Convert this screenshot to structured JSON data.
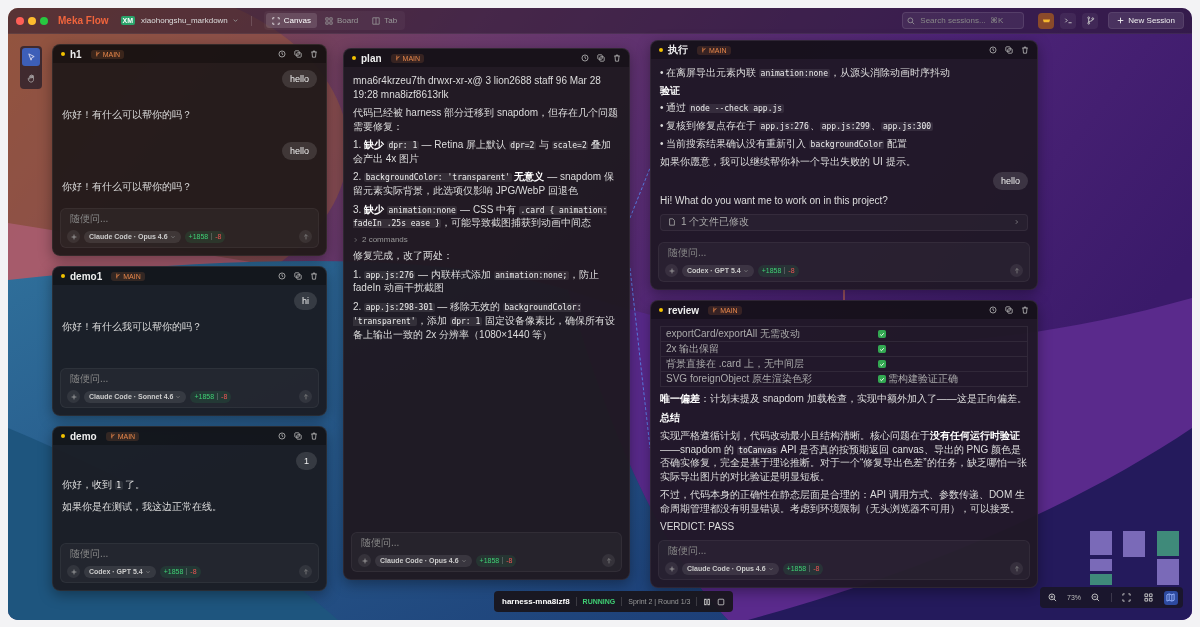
{
  "window": {
    "app_name": "Meka Flow",
    "project": {
      "initials": "XM",
      "name": "xiaohongshu_markdown"
    }
  },
  "view_tabs": [
    {
      "label": "Canvas",
      "selected": true
    },
    {
      "label": "Board",
      "selected": false
    },
    {
      "label": "Tab",
      "selected": false
    }
  ],
  "search": {
    "placeholder": "Search sessions...  ⌘K"
  },
  "new_session_button": "New Session",
  "tools": [
    {
      "kind": "select",
      "selected": true
    },
    {
      "kind": "pan",
      "selected": false
    }
  ],
  "cards": [
    {
      "title": "h1",
      "branch": "MAIN",
      "blocks": [
        {
          "kind": "user",
          "text": "hello"
        },
        {
          "kind": "assistant",
          "segments": [
            {
              "kind": "text",
              "text": "你好！有什么可以帮你的吗？"
            }
          ]
        },
        {
          "kind": "user",
          "text": "hello"
        },
        {
          "kind": "assistant",
          "segments": [
            {
              "kind": "text",
              "text": "你好！有什么可以帮你的吗？"
            }
          ]
        }
      ],
      "composer": {
        "placeholder": "随便问...",
        "model": "Claude Code · Opus 4.6",
        "added": "+1858",
        "removed": "-8"
      }
    },
    {
      "title": "demo1",
      "branch": "MAIN",
      "blocks": [
        {
          "kind": "user",
          "text": "hi"
        },
        {
          "kind": "assistant",
          "segments": [
            {
              "kind": "text",
              "text": "你好！有什么我可以帮你的吗？"
            }
          ]
        }
      ],
      "composer": {
        "placeholder": "随便问...",
        "model": "Claude Code · Sonnet 4.6",
        "added": "+1858",
        "removed": "-8"
      }
    },
    {
      "title": "demo",
      "branch": "MAIN",
      "blocks": [
        {
          "kind": "user",
          "text": "1"
        },
        {
          "kind": "assistant",
          "segments": [
            {
              "kind": "text",
              "text": "你好，收到 "
            },
            {
              "kind": "code",
              "text": "1"
            },
            {
              "kind": "text",
              "text": " 了。"
            }
          ]
        },
        {
          "kind": "assistant",
          "segments": [
            {
              "kind": "text",
              "text": "如果你是在测试，我这边正常在线。"
            }
          ]
        }
      ],
      "composer": {
        "placeholder": "随便问...",
        "model": "Codex · GPT 5.4",
        "added": "+1858",
        "removed": "-8"
      }
    },
    {
      "title": "plan",
      "branch": "MAIN",
      "blocks": [
        {
          "kind": "assistant",
          "segments": [
            {
              "kind": "text",
              "text": "mna6r4krzeu7th drwxr-xr-x@ 3 lion2688 staff 96 Mar 28 19:28 mna8izf8613rlk"
            }
          ]
        },
        {
          "kind": "assistant",
          "segments": [
            {
              "kind": "text",
              "text": "代码已经被 harness 部分迁移到 snapdom，但存在几个问题需要修复："
            }
          ]
        },
        {
          "kind": "item",
          "marker": "1.",
          "segments": [
            {
              "kind": "bold",
              "text": "缺少 "
            },
            {
              "kind": "code",
              "text": "dpr: 1"
            },
            {
              "kind": "text",
              "text": " — Retina 屏上默认 "
            },
            {
              "kind": "code",
              "text": "dpr=2"
            },
            {
              "kind": "text",
              "text": " 与 "
            },
            {
              "kind": "code",
              "text": "scale=2"
            },
            {
              "kind": "text",
              "text": " 叠加会产出 4x 图片"
            }
          ]
        },
        {
          "kind": "item",
          "marker": "2.",
          "segments": [
            {
              "kind": "code",
              "text": "backgroundColor: 'transparent'"
            },
            {
              "kind": "bold",
              "text": " 无意义"
            },
            {
              "kind": "text",
              "text": " — snapdom 保留元素实际背景，此选项仅影响 JPG/WebP 回退色"
            }
          ]
        },
        {
          "kind": "item",
          "marker": "3.",
          "segments": [
            {
              "kind": "bold",
              "text": "缺少 "
            },
            {
              "kind": "code",
              "text": "animation:none"
            },
            {
              "kind": "text",
              "text": " — CSS 中有 "
            },
            {
              "kind": "code",
              "text": ".card { animation: fadeIn .25s ease }"
            },
            {
              "kind": "text",
              "text": "，可能导致截图捕获到动画中间态"
            }
          ]
        },
        {
          "kind": "commands",
          "text": "2 commands"
        },
        {
          "kind": "assistant",
          "segments": [
            {
              "kind": "text",
              "text": "修复完成，改了两处："
            }
          ]
        },
        {
          "kind": "item",
          "marker": "1.",
          "segments": [
            {
              "kind": "code",
              "text": "app.js:276"
            },
            {
              "kind": "text",
              "text": " — 内联样式添加 "
            },
            {
              "kind": "code",
              "text": "animation:none;"
            },
            {
              "kind": "text",
              "text": "，防止 fadeIn 动画干扰截图"
            }
          ]
        },
        {
          "kind": "item",
          "marker": "2.",
          "segments": [
            {
              "kind": "code",
              "text": "app.js:298-301"
            },
            {
              "kind": "text",
              "text": " — 移除无效的 "
            },
            {
              "kind": "code",
              "text": "backgroundColor: 'transparent'"
            },
            {
              "kind": "text",
              "text": "，添加 "
            },
            {
              "kind": "code",
              "text": "dpr: 1"
            },
            {
              "kind": "text",
              "text": " 固定设备像素比，确保所有设备上输出一致的 2x 分辨率（1080×1440 等）"
            }
          ]
        }
      ],
      "composer": {
        "placeholder": "随便问...",
        "model": "Claude Code · Opus 4.6",
        "added": "+1858",
        "removed": "-8"
      }
    },
    {
      "title": "执行",
      "branch": "MAIN",
      "blocks": [
        {
          "kind": "item",
          "marker": "•",
          "segments": [
            {
              "kind": "text",
              "text": "在离屏导出元素内联 "
            },
            {
              "kind": "code",
              "text": "animation:none"
            },
            {
              "kind": "text",
              "text": "，从源头消除动画时序抖动"
            }
          ]
        },
        {
          "kind": "heading",
          "text": "验证"
        },
        {
          "kind": "item",
          "marker": "•",
          "segments": [
            {
              "kind": "text",
              "text": "通过 "
            },
            {
              "kind": "code",
              "text": "node --check app.js"
            }
          ]
        },
        {
          "kind": "item",
          "marker": "•",
          "segments": [
            {
              "kind": "text",
              "text": "复核到修复点存在于 "
            },
            {
              "kind": "code",
              "text": "app.js:276"
            },
            {
              "kind": "text",
              "text": "、"
            },
            {
              "kind": "code",
              "text": "app.js:299"
            },
            {
              "kind": "text",
              "text": "、"
            },
            {
              "kind": "code",
              "text": "app.js:300"
            }
          ]
        },
        {
          "kind": "item",
          "marker": "•",
          "segments": [
            {
              "kind": "text",
              "text": "当前搜索结果确认没有重新引入 "
            },
            {
              "kind": "code",
              "text": "backgroundColor"
            },
            {
              "kind": "text",
              "text": " 配置"
            }
          ]
        },
        {
          "kind": "assistant",
          "segments": [
            {
              "kind": "text",
              "text": "如果你愿意，我可以继续帮你补一个导出失败的 UI 提示。"
            }
          ]
        },
        {
          "kind": "user",
          "text": "hello"
        },
        {
          "kind": "assistant",
          "segments": [
            {
              "kind": "text",
              "text": "Hi! What do you want me to work on in this project?"
            }
          ]
        },
        {
          "kind": "file-change",
          "text": "1 个文件已修改"
        }
      ],
      "composer": {
        "placeholder": "随便问...",
        "model": "Codex · GPT 5.4",
        "added": "+1858",
        "removed": "-8"
      }
    },
    {
      "title": "review",
      "branch": "MAIN",
      "blocks": [
        {
          "kind": "table",
          "rows": [
            {
              "item": "exportCard/exportAll 无需改动",
              "checked": true
            },
            {
              "item": "2x 输出保留",
              "checked": true
            },
            {
              "item": "背景直接在 .card 上，无中间层",
              "checked": true
            },
            {
              "item": "SVG foreignObject 原生渲染色彩",
              "checked": true,
              "note": "需构建验证正确"
            }
          ]
        },
        {
          "kind": "assistant",
          "segments": [
            {
              "kind": "bold",
              "text": "唯一偏差"
            },
            {
              "kind": "text",
              "text": "：计划未提及 snapdom 加载检查，实现中额外加入了——这是正向偏差。"
            }
          ]
        },
        {
          "kind": "heading",
          "text": "总结"
        },
        {
          "kind": "assistant",
          "segments": [
            {
              "kind": "text",
              "text": "实现严格遵循计划，代码改动最小且结构清晰。核心问题在于"
            },
            {
              "kind": "bold",
              "text": "没有任何运行时验证"
            },
            {
              "kind": "text",
              "text": "——snapdom 的 "
            },
            {
              "kind": "code",
              "text": "toCanvas"
            },
            {
              "kind": "text",
              "text": " API 是否真的按预期返回 canvas、导出的 PNG 颜色是否确实修复，完全是基于理论推断。对于一个“修复导出色差”的任务，缺乏哪怕一张实际导出图片的对比验证是明显短板。"
            }
          ]
        },
        {
          "kind": "assistant",
          "segments": [
            {
              "kind": "text",
              "text": "不过，代码本身的正确性在静态层面是合理的：API 调用方式、参数传递、DOM 生命周期管理都没有明显错误。考虑到环境限制（无头浏览器不可用），可以接受。"
            }
          ]
        },
        {
          "kind": "assistant",
          "segments": [
            {
              "kind": "text",
              "text": "VERDICT: PASS"
            }
          ]
        }
      ],
      "composer": {
        "placeholder": "随便问...",
        "model": "Claude Code · Opus 4.6",
        "added": "+1858",
        "removed": "-8"
      }
    }
  ],
  "status_bar": {
    "session": "harness-mna8izf8",
    "state": "RUNNING",
    "progress": "Sprint 2 | Round 1/3"
  },
  "zoom": {
    "level_label": "73%",
    "minimap_selected": true
  }
}
